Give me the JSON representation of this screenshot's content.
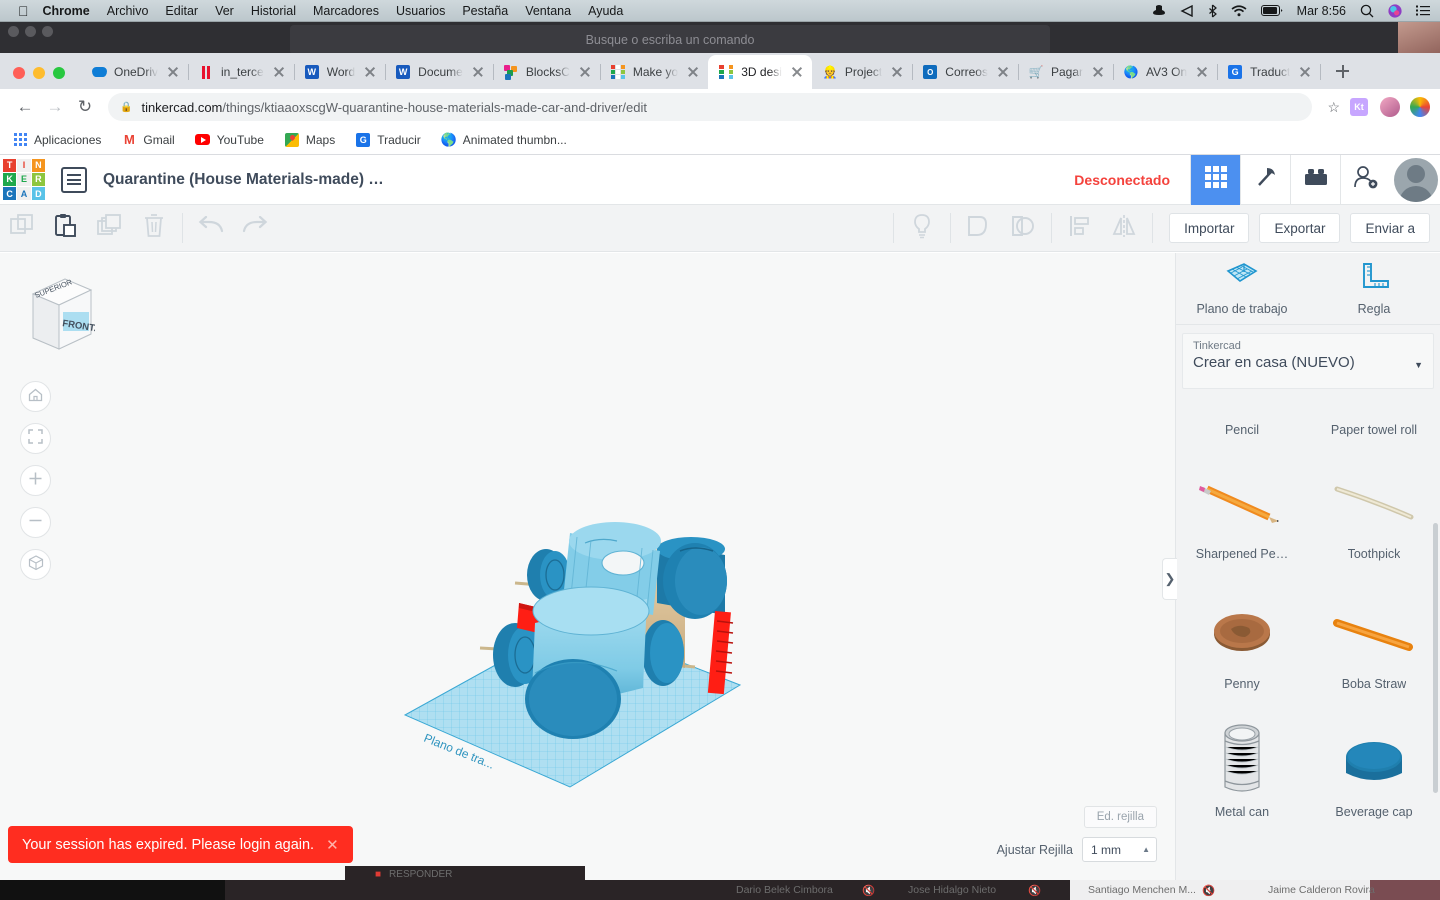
{
  "menubar": {
    "apple_icon": "apple-icon",
    "items": [
      "Chrome",
      "Archivo",
      "Editar",
      "Ver",
      "Historial",
      "Marcadores",
      "Usuarios",
      "Pestaña",
      "Ventana",
      "Ayuda"
    ],
    "status_icons": [
      "hat-icon",
      "airplay-icon",
      "bluetooth-icon",
      "wifi-icon",
      "battery-icon"
    ],
    "clock": "Mar 8:56",
    "right_icons": [
      "search-icon",
      "siri-icon",
      "control-center-icon"
    ]
  },
  "background_window": {
    "command_placeholder": "Busque o escriba un comando"
  },
  "browser": {
    "tabs": [
      {
        "label": "OneDriv",
        "favicon": "onedrive-icon",
        "active": false
      },
      {
        "label": "in_terce",
        "favicon": "pause-bars-icon",
        "active": false
      },
      {
        "label": "Word",
        "favicon": "word-icon",
        "active": false
      },
      {
        "label": "Docume",
        "favicon": "word-icon",
        "active": false
      },
      {
        "label": "BlocksC",
        "favicon": "blockscad-icon",
        "active": false
      },
      {
        "label": "Make yo",
        "favicon": "tinkercad-icon",
        "active": false
      },
      {
        "label": "3D desi",
        "favicon": "tinkercad-icon",
        "active": true
      },
      {
        "label": "Project",
        "favicon": "project-icon",
        "active": false
      },
      {
        "label": "Correos",
        "favicon": "outlook-icon",
        "active": false
      },
      {
        "label": "Pagar",
        "favicon": "cart-icon",
        "active": false
      },
      {
        "label": "AV3 On",
        "favicon": "globe-icon",
        "active": false
      },
      {
        "label": "Traduct",
        "favicon": "google-translate-icon",
        "active": false
      }
    ],
    "new_tab_label": "+",
    "nav": {
      "back": "back-icon",
      "forward": "forward-icon",
      "reload": "reload-icon"
    },
    "url": {
      "lock": "lock-icon",
      "domain": "tinkercad.com",
      "path": "/things/ktiaaoxscgW-quarantine-house-materials-made-car-and-driver/edit",
      "star": "star-icon"
    },
    "profile_badges": [
      "kt-extension-icon",
      "profile-avatar",
      "extension-icon"
    ],
    "bookmarks": [
      {
        "label": "Aplicaciones",
        "icon": "apps-grid-icon"
      },
      {
        "label": "Gmail",
        "icon": "gmail-icon"
      },
      {
        "label": "YouTube",
        "icon": "youtube-icon"
      },
      {
        "label": "Maps",
        "icon": "maps-icon"
      },
      {
        "label": "Traducir",
        "icon": "google-translate-icon"
      },
      {
        "label": "Animated thumbn...",
        "icon": "globe-icon"
      }
    ]
  },
  "tinkercad": {
    "logo_letters": [
      "T",
      "I",
      "N",
      "K",
      "E",
      "R",
      "C",
      "A",
      "D"
    ],
    "logo_colors": [
      "#e8402f",
      "#f0f0f0",
      "#f5951e",
      "#1fa84c",
      "#f0f0f0",
      "#8dc63f",
      "#1b75bb",
      "#f0f0f0",
      "#59c3e8"
    ],
    "menu_icon": "list-menu-icon",
    "project_title": "Quarantine (House Materials-made) …",
    "connection_status": "Desconectado",
    "status_color": "#f4423c",
    "header_buttons": [
      {
        "name": "blocks-view-button",
        "icon": "grid-squares-icon",
        "selected": true
      },
      {
        "name": "tools-button",
        "icon": "hammer-pick-icon",
        "selected": false
      },
      {
        "name": "bricks-button",
        "icon": "lego-brick-icon",
        "selected": false
      },
      {
        "name": "invite-user-button",
        "icon": "add-person-icon",
        "selected": false
      }
    ],
    "avatar": "user-avatar",
    "toolbar_left": [
      {
        "name": "copy-button",
        "icon": "copy-icon",
        "enabled": false
      },
      {
        "name": "paste-button",
        "icon": "clipboard-paste-icon",
        "enabled": true
      },
      {
        "name": "duplicate-button",
        "icon": "duplicate-icon",
        "enabled": false
      },
      {
        "name": "delete-button",
        "icon": "trash-icon",
        "enabled": false
      },
      {
        "name": "undo-button",
        "icon": "undo-arrow-icon",
        "enabled": false
      },
      {
        "name": "redo-button",
        "icon": "redo-arrow-icon",
        "enabled": false
      }
    ],
    "toolbar_right_icons": [
      {
        "name": "light-bulb-button",
        "icon": "lightbulb-icon"
      },
      {
        "name": "group-button",
        "icon": "group-shapes-icon"
      },
      {
        "name": "ungroup-button",
        "icon": "ungroup-shapes-icon"
      },
      {
        "name": "align-button",
        "icon": "align-icon"
      },
      {
        "name": "mirror-button",
        "icon": "mirror-icon"
      }
    ],
    "toolbar_buttons": [
      "Importar",
      "Exportar",
      "Enviar a"
    ],
    "canvas": {
      "viewcube": {
        "top_label": "SUPERIOR",
        "front_label": "FRONTAL"
      },
      "nav_controls": [
        {
          "name": "home-view-button",
          "icon": "home-icon"
        },
        {
          "name": "fit-view-button",
          "icon": "fit-frame-icon"
        },
        {
          "name": "zoom-in-button",
          "icon": "plus-icon"
        },
        {
          "name": "zoom-out-button",
          "icon": "minus-icon"
        },
        {
          "name": "orthographic-toggle-button",
          "icon": "cube-icon"
        }
      ],
      "workplane_label": "Plano de trabajo",
      "grid_edit_button": "Ed. rejilla",
      "snap_label": "Ajustar Rejilla",
      "snap_value": "1 mm"
    },
    "panel": {
      "tools": [
        {
          "label": "Plano de trabajo",
          "icon": "workplane-icon"
        },
        {
          "label": "Regla",
          "icon": "ruler-icon"
        }
      ],
      "library": {
        "group": "Tinkercad",
        "collection": "Crear en casa (NUEVO)",
        "caret": "chevron-down-icon"
      },
      "top_partial_captions": [
        "Pencil",
        "Paper towel roll"
      ],
      "items": [
        {
          "label": "Sharpened Pe…",
          "icon": "pencil-3d-icon"
        },
        {
          "label": "Toothpick",
          "icon": "toothpick-3d-icon"
        },
        {
          "label": "Penny",
          "icon": "penny-3d-icon"
        },
        {
          "label": "Boba Straw",
          "icon": "straw-3d-icon"
        },
        {
          "label": "Metal can",
          "icon": "metal-can-3d-icon"
        },
        {
          "label": "Beverage cap",
          "icon": "beverage-cap-3d-icon"
        }
      ],
      "collapse_icon": "chevron-right-icon"
    }
  },
  "toast": {
    "message": "Your session has expired. Please login again.",
    "close_icon": "close-icon",
    "background": "#ff2d20"
  },
  "bottom_strip": {
    "responder_label": "RESPONDER",
    "participants": [
      "Dario Belek Cimbora",
      "Jose Hidalgo Nieto",
      "Santiago Menchen M...",
      "Jaime Calderon Rovira"
    ],
    "mute_icon": "mic-muted-icon"
  }
}
